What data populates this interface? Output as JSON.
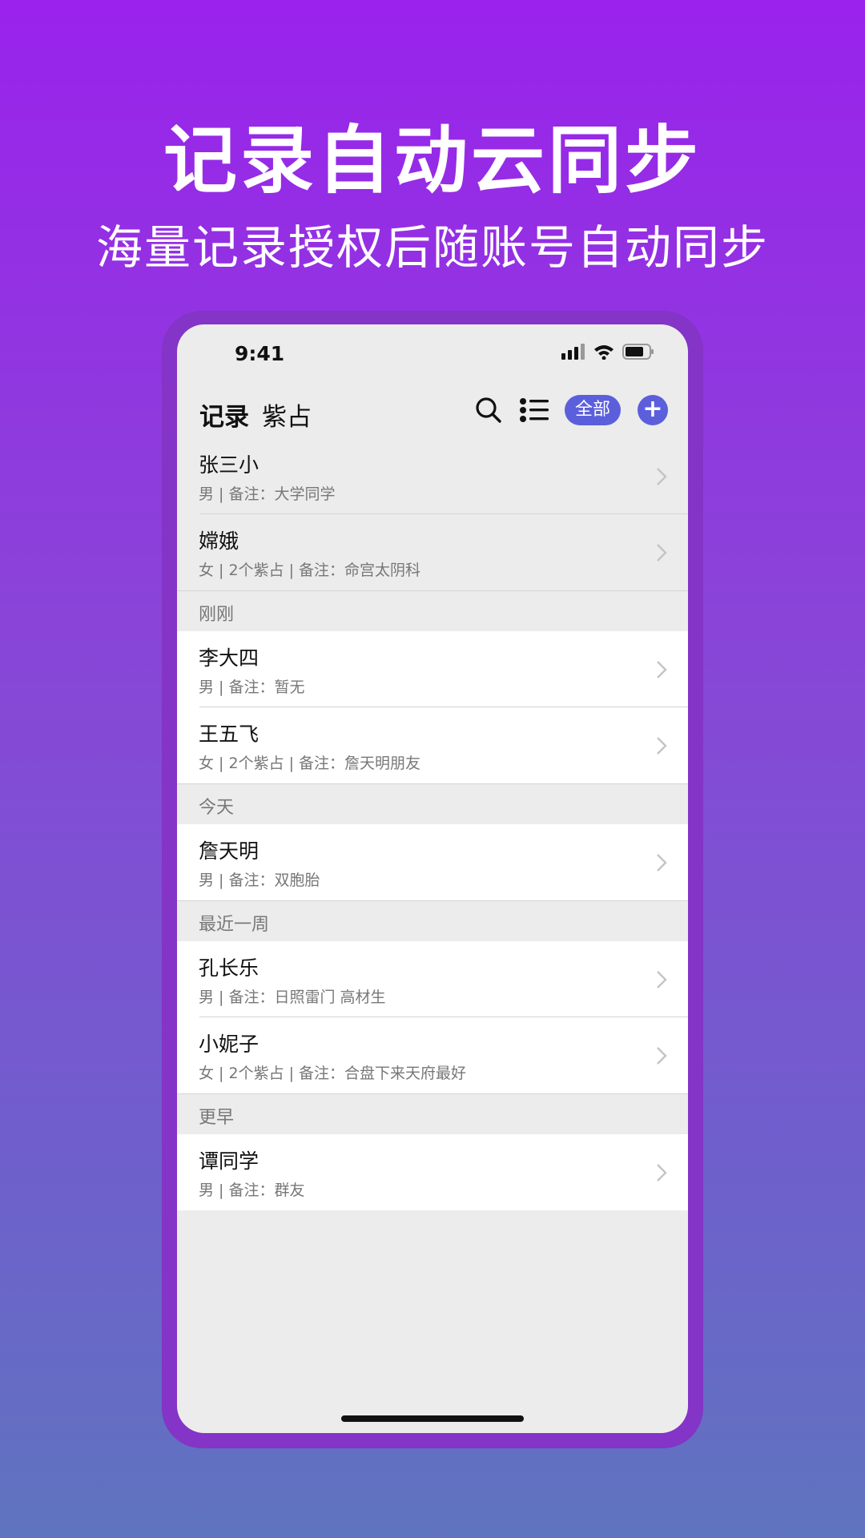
{
  "hero": {
    "title": "记录自动云同步",
    "subtitle": "海量记录授权后随账号自动同步"
  },
  "status_bar": {
    "time": "9:41"
  },
  "nav": {
    "tabs": [
      {
        "label": "记录",
        "active": true
      },
      {
        "label": "紫占",
        "active": false
      }
    ],
    "filter_label": "全部",
    "add_label": "+"
  },
  "list": {
    "top_rows": [
      {
        "name": "张三小",
        "detail": "男 | 备注：大学同学"
      },
      {
        "name": "嫦娥",
        "detail": "女 | 2个紫占 | 备注：命宫太阴科"
      }
    ],
    "sections": [
      {
        "title": "刚刚",
        "rows": [
          {
            "name": "李大四",
            "detail": "男 | 备注：暂无"
          },
          {
            "name": "王五飞",
            "detail": "女 | 2个紫占 | 备注：詹天明朋友"
          }
        ]
      },
      {
        "title": "今天",
        "rows": [
          {
            "name": "詹天明",
            "detail": "男 | 备注：双胞胎"
          }
        ]
      },
      {
        "title": "最近一周",
        "rows": [
          {
            "name": "孔长乐",
            "detail": "男 | 备注：日照雷门 高材生"
          },
          {
            "name": "小妮子",
            "detail": "女 | 2个紫占 | 备注：合盘下来天府最好"
          }
        ]
      },
      {
        "title": "更早",
        "rows": [
          {
            "name": "谭同学",
            "detail": "男 | 备注：群友"
          }
        ]
      }
    ]
  },
  "colors": {
    "accent": "#5c5fdb",
    "background_top": "#9a22ec",
    "background_bottom": "#5f74bf",
    "phone_frame": "#8434c6"
  },
  "icons": {
    "search": "search-icon",
    "list": "list-icon",
    "chevron": "chevron-right-icon",
    "signal": "signal-icon",
    "wifi": "wifi-icon",
    "battery": "battery-icon"
  }
}
